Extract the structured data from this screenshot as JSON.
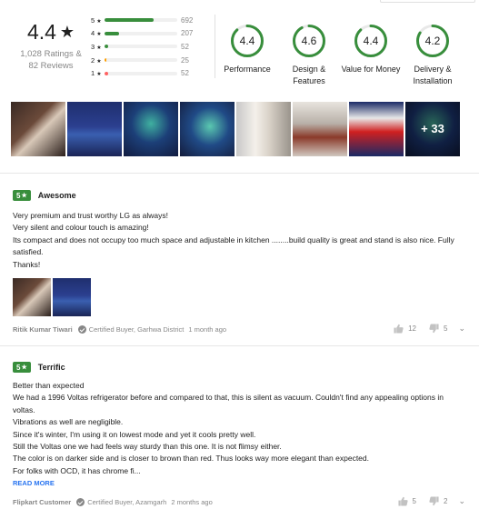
{
  "summary": {
    "avg": "4.4",
    "star": "★",
    "ratings_text": "1,028 Ratings &",
    "reviews_text": "82 Reviews",
    "distribution": [
      {
        "label": "5",
        "count": "692",
        "fraction": 0.673,
        "color": "#388e3c"
      },
      {
        "label": "4",
        "count": "207",
        "fraction": 0.201,
        "color": "#388e3c"
      },
      {
        "label": "3",
        "count": "52",
        "fraction": 0.051,
        "color": "#388e3c"
      },
      {
        "label": "2",
        "count": "25",
        "fraction": 0.024,
        "color": "#ff9f00"
      },
      {
        "label": "1",
        "count": "52",
        "fraction": 0.051,
        "color": "#ff6161"
      }
    ],
    "aspects": [
      {
        "value": "4.4",
        "fraction": 0.88,
        "name_line1": "Performance",
        "name_line2": ""
      },
      {
        "value": "4.6",
        "fraction": 0.92,
        "name_line1": "Design &",
        "name_line2": "Features"
      },
      {
        "value": "4.4",
        "fraction": 0.88,
        "name_line1": "Value for Money",
        "name_line2": ""
      },
      {
        "value": "4.2",
        "fraction": 0.84,
        "name_line1": "Delivery &",
        "name_line2": "Installation"
      }
    ],
    "ring_color": "#388e3c",
    "more_photos": "+ 33"
  },
  "reviews": [
    {
      "rating": "5",
      "title": "Awesome",
      "body": [
        "Very premium and trust worthy LG as always!",
        "Very silent and colour touch is amazing!",
        "Its compact and does not occupy too much space and adjustable in kitchen ........build quality is great and stand is also nice. Fully satisfied.",
        "Thanks!"
      ],
      "author": "Ritik Kumar Tiwari",
      "certified": "Certified Buyer, Garhwa District",
      "time": "1 month ago",
      "likes": "12",
      "dislikes": "5"
    },
    {
      "rating": "5",
      "title": "Terrific",
      "body": [
        "Better than expected",
        "We had a 1996 Voltas refrigerator before and compared to that, this is silent as vacuum. Couldn't find any appealing options in voltas.",
        "Vibrations as well are negligible.",
        "Since it's winter, I'm using it on lowest mode and yet it cools pretty well.",
        "Still the Voltas one we had feels way sturdy than this one. It is not flimsy either.",
        "The color is on darker side and is closer to brown than red. Thus looks way more elegant than expected.",
        "For folks with OCD, it has chrome fi..."
      ],
      "read_more": "READ MORE",
      "author": "Flipkart Customer",
      "certified": "Certified Buyer, Azamgarh",
      "time": "2 months ago",
      "likes": "5",
      "dislikes": "2"
    }
  ]
}
